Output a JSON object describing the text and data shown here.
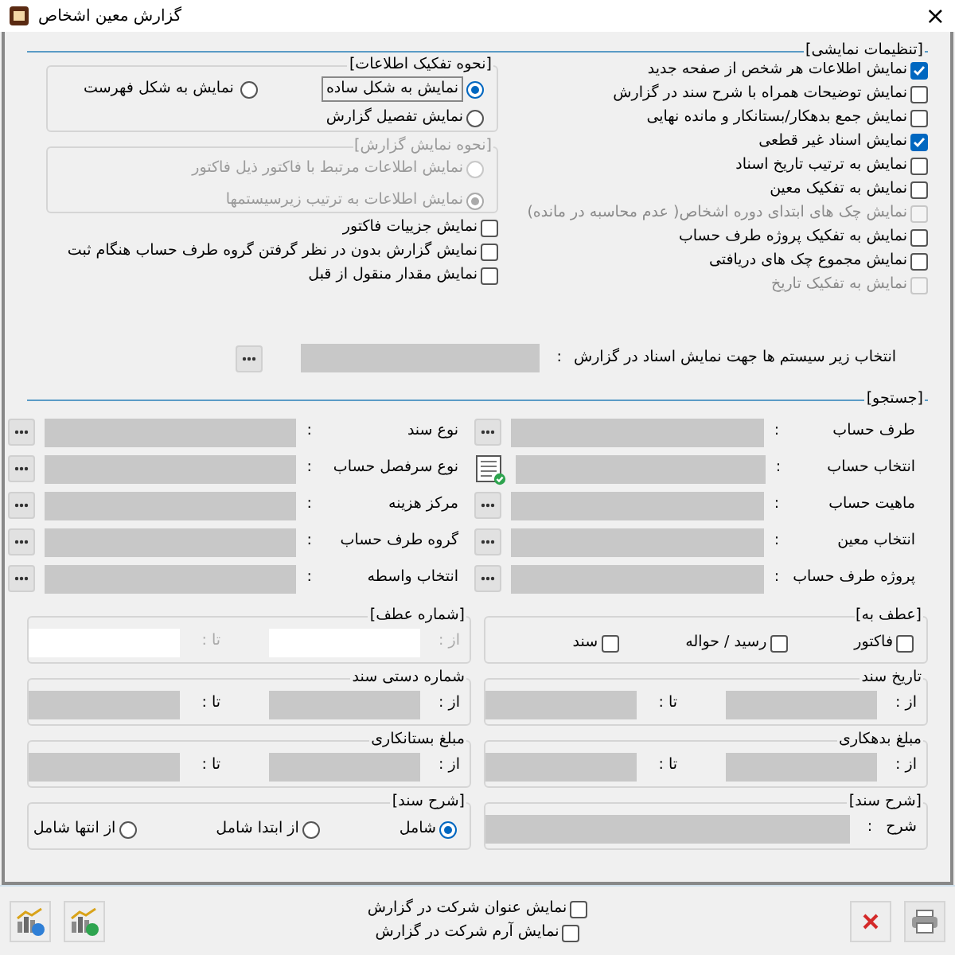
{
  "window": {
    "title": "گزارش معین اشخاص",
    "close": "×"
  },
  "display_settings": {
    "title": "[تنظیمات نمایشی]",
    "options": [
      {
        "label": "نمایش اطلاعات هر شخص از صفحه جدید",
        "checked": true,
        "disabled": false
      },
      {
        "label": "نمایش توضیحات همراه با شرح سند در گزارش",
        "checked": false,
        "disabled": false
      },
      {
        "label": "نمایش جمع بدهکار/بستانکار و مانده نهایی",
        "checked": false,
        "disabled": false
      },
      {
        "label": "نمایش اسناد غیر قطعی",
        "checked": true,
        "disabled": false
      },
      {
        "label": "نمایش به ترتیب تاریخ اسناد",
        "checked": false,
        "disabled": false
      },
      {
        "label": "نمایش به تفکیک معین",
        "checked": false,
        "disabled": false
      },
      {
        "label": "نمایش چک های ابتدای دوره  اشخاص( عدم محاسبه در مانده)",
        "checked": false,
        "disabled": true
      },
      {
        "label": "نمایش به تفکیک پروژه طرف حساب",
        "checked": false,
        "disabled": false
      },
      {
        "label": "نمایش مجموع چک های دریافتی",
        "checked": false,
        "disabled": false
      },
      {
        "label": "نمایش به تفکیک تاریخ",
        "checked": false,
        "disabled": true
      }
    ],
    "breakdown": {
      "title": "[نحوه تفکیک اطلاعات]",
      "options": [
        {
          "label": "نمایش به شکل ساده",
          "selected": true
        },
        {
          "label": "نمایش به شکل فهرست",
          "selected": false
        },
        {
          "label": "نمایش تفصیل گزارش",
          "selected": false
        }
      ]
    },
    "report_mode": {
      "title": "[نحوه نمایش گزارش]",
      "disabled": true,
      "options": [
        {
          "label": "نمایش اطلاعات مرتبط با فاکتور ذیل فاکتور",
          "selected": false
        },
        {
          "label": "نمایش اطلاعات به ترتیب زیرسیستمها",
          "selected": true
        }
      ]
    },
    "extra_options": [
      {
        "label": "نمایش جزییات فاکتور",
        "checked": false
      },
      {
        "label": "نمایش گزارش بدون در نظر گرفتن گروه طرف حساب هنگام ثبت",
        "checked": false
      },
      {
        "label": "نمایش مقدار منقول از قبل",
        "checked": false
      }
    ],
    "subsystem": {
      "label": "انتخاب زیر سیستم ها جهت نمایش اسناد در گزارش",
      "sep": ":"
    }
  },
  "search": {
    "title": "[جستجو]",
    "right_fields": [
      {
        "label": "طرف حساب",
        "sep": ":",
        "kind": "browse"
      },
      {
        "label": "انتخاب حساب",
        "sep": ":",
        "kind": "list"
      },
      {
        "label": "ماهیت حساب",
        "sep": ":",
        "kind": "browse"
      },
      {
        "label": "انتخاب معین",
        "sep": ":",
        "kind": "browse"
      },
      {
        "label": "پروژه طرف حساب",
        "sep": ":",
        "kind": "browse"
      }
    ],
    "left_fields": [
      {
        "label": "نوع سند",
        "sep": ":",
        "kind": "browse"
      },
      {
        "label": "نوع سرفصل حساب",
        "sep": ":",
        "kind": "browse"
      },
      {
        "label": "مرکز هزینه",
        "sep": ":",
        "kind": "browse"
      },
      {
        "label": "گروه طرف حساب",
        "sep": ":",
        "kind": "browse"
      },
      {
        "label": "انتخاب واسطه",
        "sep": ":",
        "kind": "browse"
      }
    ]
  },
  "reference": {
    "title": "[عطف به]",
    "options": [
      {
        "label": "فاکتور",
        "checked": false
      },
      {
        "label": "رسید / حواله",
        "checked": false
      },
      {
        "label": "سند",
        "checked": false
      }
    ]
  },
  "reference_number": {
    "title": "[شماره عطف]",
    "from": "از :",
    "to": "تا :",
    "disabled": true
  },
  "ranges": [
    {
      "title": "تاریخ سند",
      "from": "از :",
      "to": "تا :"
    },
    {
      "title": "شماره دستی سند",
      "from": "از :",
      "to": "تا :"
    },
    {
      "title": "مبلغ بدهکاری",
      "from": "از :",
      "to": "تا :"
    },
    {
      "title": "مبلغ بستانکاری",
      "from": "از :",
      "to": "تا :"
    }
  ],
  "description": {
    "title": "[شرح سند]",
    "label": "شرح",
    "sep": ":"
  },
  "match": {
    "title": "[شرح سند]",
    "options": [
      {
        "label": "شامل",
        "selected": true
      },
      {
        "label": "از ابتدا شامل",
        "selected": false
      },
      {
        "label": "از انتها شامل",
        "selected": false
      }
    ]
  },
  "footer": {
    "options": [
      {
        "label": "نمایش عنوان شرکت در گزارش",
        "checked": false
      },
      {
        "label": "نمایش آرم شرکت در گزارش",
        "checked": false
      }
    ]
  }
}
